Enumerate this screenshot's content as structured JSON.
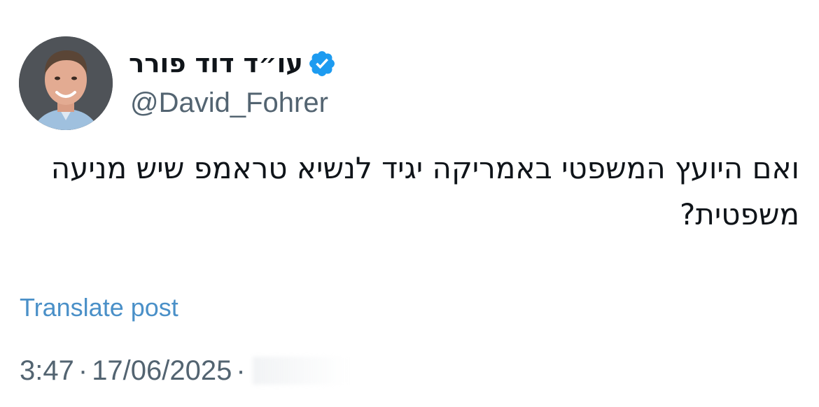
{
  "author": {
    "display_name": "עו״ד דוד פורר",
    "handle": "@David_Fohrer",
    "verified": true,
    "verified_color": "#1d9bf0"
  },
  "post": {
    "text": "ואם היועץ המשפטי באמריקה יגיד לנשיא טראמפ שיש מניעה משפטית?",
    "translate_label": "Translate post",
    "time": "3:47",
    "date": "17/06/2025",
    "separator": "·"
  },
  "colors": {
    "text": "#0f1419",
    "secondary": "#536471",
    "link": "#4a90c8"
  }
}
